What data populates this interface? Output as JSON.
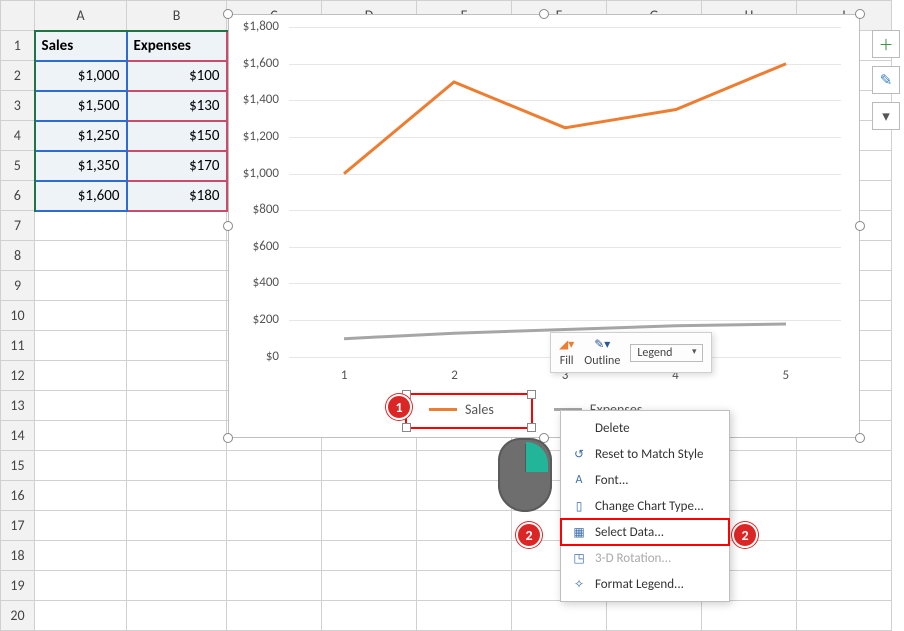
{
  "columns": [
    "A",
    "B",
    "C",
    "D",
    "E",
    "F",
    "G",
    "H",
    "I"
  ],
  "rows": [
    "1",
    "2",
    "3",
    "4",
    "5",
    "6",
    "7",
    "8",
    "9",
    "10",
    "11",
    "12",
    "13",
    "14",
    "15",
    "16",
    "17",
    "18",
    "19",
    "20"
  ],
  "table": {
    "headers": {
      "a": "Sales",
      "b": "Expenses"
    },
    "data": [
      {
        "a": "$1,000",
        "b": "$100"
      },
      {
        "a": "$1,500",
        "b": "$130"
      },
      {
        "a": "$1,250",
        "b": "$150"
      },
      {
        "a": "$1,350",
        "b": "$170"
      },
      {
        "a": "$1,600",
        "b": "$180"
      }
    ]
  },
  "chart_data": {
    "type": "line",
    "categories": [
      1,
      2,
      3,
      4,
      5
    ],
    "series": [
      {
        "name": "Sales",
        "values": [
          1000,
          1500,
          1250,
          1350,
          1600
        ],
        "color": "#ed7d31"
      },
      {
        "name": "Expenses",
        "values": [
          100,
          130,
          150,
          170,
          180
        ],
        "color": "#a6a6a6"
      }
    ],
    "ylim": [
      0,
      1800
    ],
    "yticks": [
      "$0",
      "$200",
      "$400",
      "$600",
      "$800",
      "$1,000",
      "$1,200",
      "$1,400",
      "$1,600",
      "$1,800"
    ],
    "legend_position": "bottom"
  },
  "legend": {
    "sales": "Sales",
    "expenses": "Expenses"
  },
  "mini_toolbar": {
    "fill": "Fill",
    "outline": "Outline",
    "type": "Legend"
  },
  "context_menu": {
    "delete": "Delete",
    "reset": "Reset to Match Style",
    "font": "Font...",
    "change_type": "Change Chart Type...",
    "select_data": "Select Data...",
    "rotation": "3-D Rotation...",
    "format_legend": "Format Legend..."
  },
  "callouts": {
    "one": "1",
    "two": "2"
  }
}
